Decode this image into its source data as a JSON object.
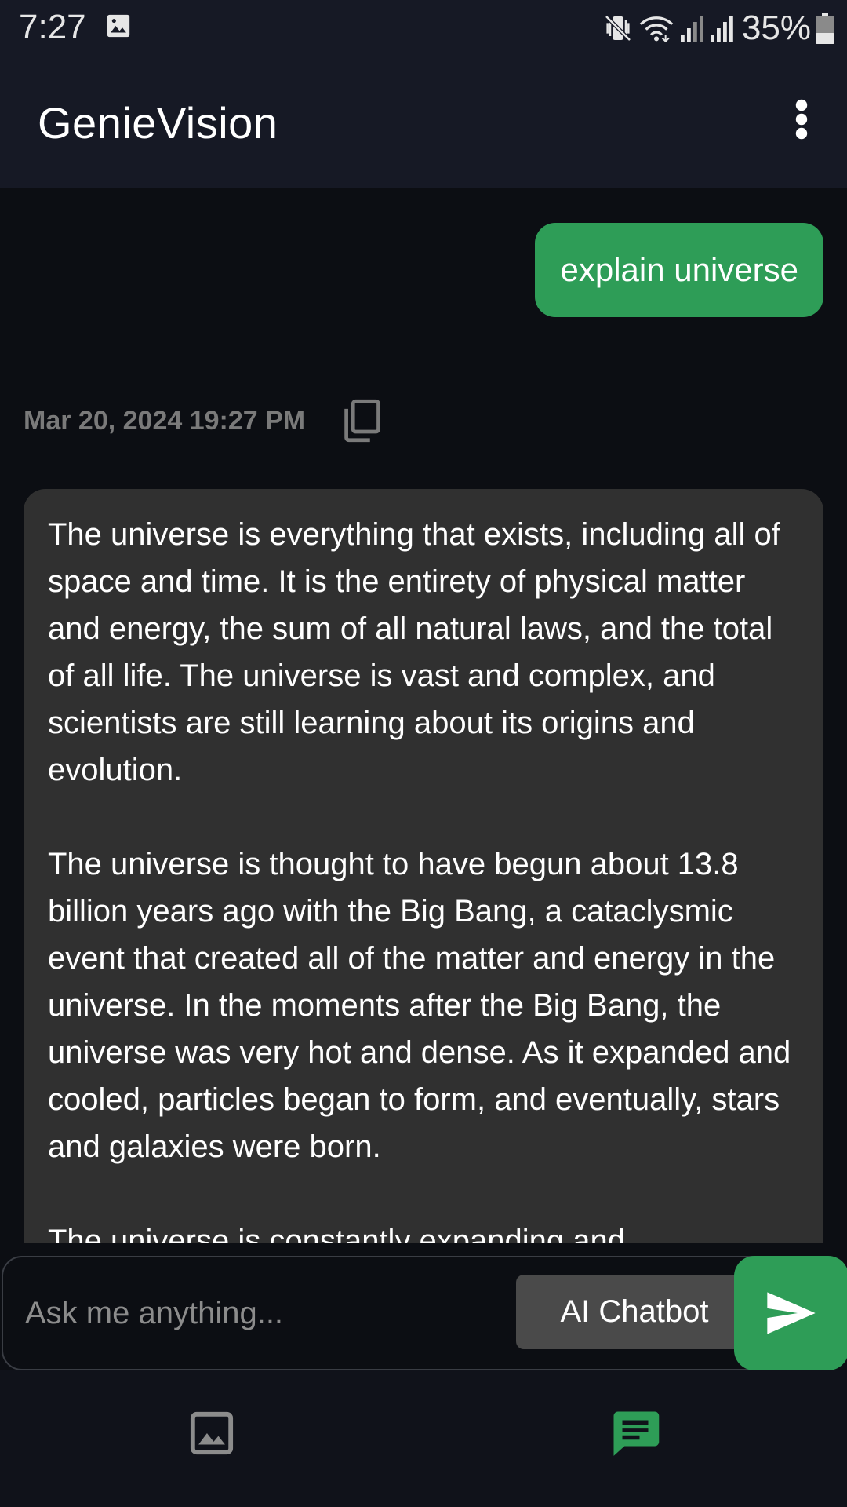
{
  "status_bar": {
    "time": "7:27",
    "battery": "35%",
    "icons": [
      "gallery-notification-icon",
      "vibrate-icon",
      "wifi-icon",
      "signal-icon",
      "signal-icon",
      "battery-icon"
    ]
  },
  "app_bar": {
    "title": "GenieVision",
    "menu_icon": "more-vert-icon"
  },
  "conversation": {
    "user_message": "explain universe",
    "timestamp": "Mar 20, 2024 19:27 PM",
    "copy_icon": "copy-icon",
    "ai_paragraphs": [
      "The universe is everything that exists, including all of space and time. It is the entirety of physical matter and energy, the sum of all natural laws, and the total of all life. The universe is vast and complex, and scientists are still learning about its origins and evolution.",
      "The universe is thought to have begun about 13.8 billion years ago with the Big Bang, a cataclysmic event that created all of the matter and energy in the universe. In the moments after the Big Bang, the universe was very hot and dense. As it expanded and cooled, particles began to form, and eventually, stars and galaxies were born.",
      "The universe is constantly expanding and"
    ]
  },
  "input": {
    "placeholder": "Ask me anything...",
    "value": "",
    "mode_label": "AI Chatbot",
    "send_icon": "send-icon"
  },
  "bottom_nav": {
    "items": [
      {
        "icon": "image-icon",
        "active": false
      },
      {
        "icon": "chat-icon",
        "active": true
      }
    ]
  },
  "colors": {
    "accent": "#2e9d57",
    "background": "#0c0e13",
    "bar": "#161925",
    "ai_bubble": "#303030",
    "timestamp": "#7a7a7a"
  }
}
